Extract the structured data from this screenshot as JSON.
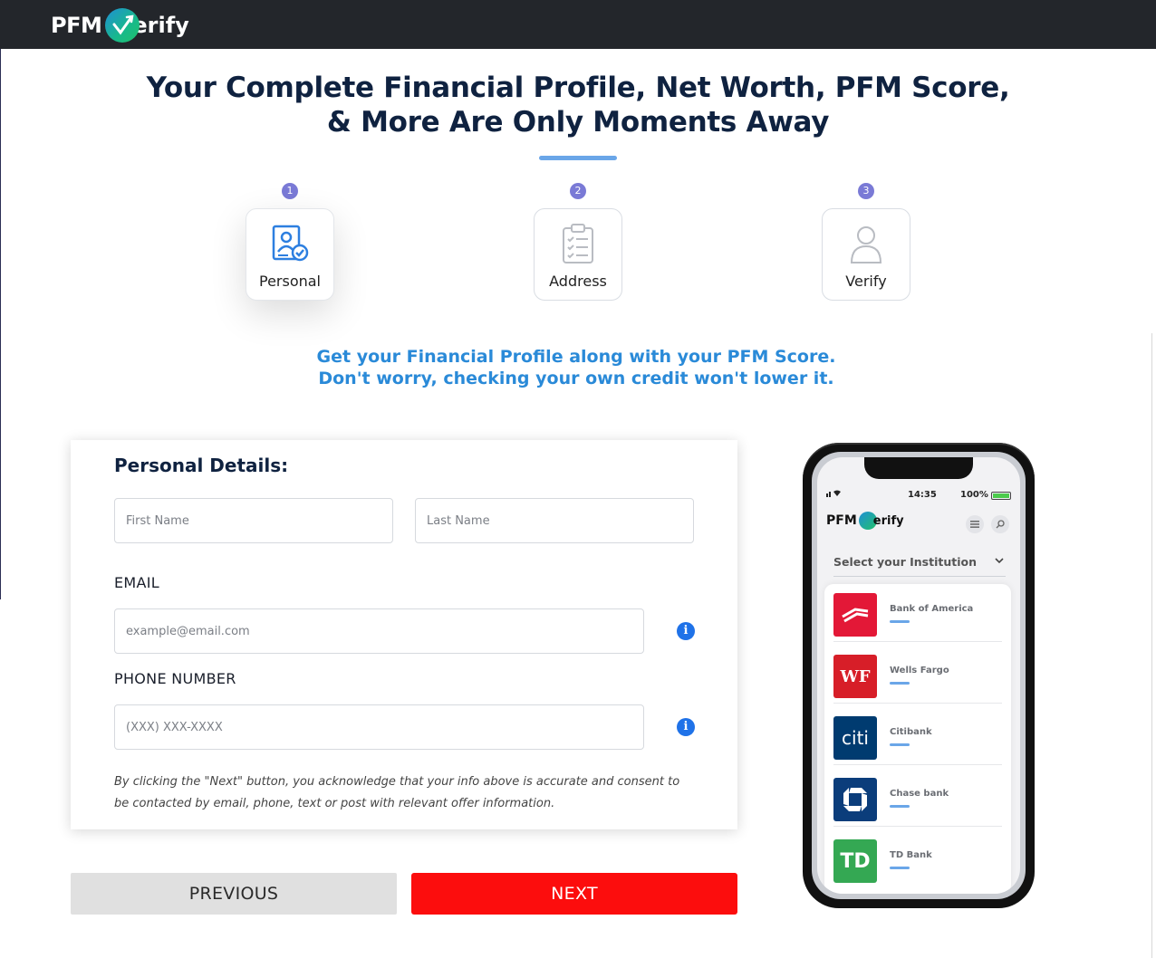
{
  "brand": {
    "prefix": "PFM",
    "suffix": "erify"
  },
  "headline": {
    "line1": "Your Complete Financial Profile, Net Worth, PFM Score,",
    "line2": "& More Are Only Moments Away"
  },
  "steps": [
    {
      "number": "1",
      "label": "Personal",
      "icon": "personal-id-check-icon",
      "active": true
    },
    {
      "number": "2",
      "label": "Address",
      "icon": "clipboard-checklist-icon",
      "active": false
    },
    {
      "number": "3",
      "label": "Verify",
      "icon": "user-outline-icon",
      "active": false
    }
  ],
  "subheadline": {
    "line1": "Get your Financial Profile along with your PFM Score.",
    "line2": "Don't worry, checking your own credit won't lower it."
  },
  "form": {
    "title": "Personal Details:",
    "first_name": {
      "placeholder": "First Name",
      "value": ""
    },
    "last_name": {
      "placeholder": "Last Name",
      "value": ""
    },
    "email": {
      "label": "EMAIL",
      "placeholder": "example@email.com",
      "value": ""
    },
    "phone": {
      "label": "PHONE NUMBER",
      "placeholder": "(XXX) XXX-XXXX",
      "value": ""
    },
    "info_icon": "i",
    "consent_line1": "By clicking the \"Next\" button, you acknowledge that your info above is accurate and consent to",
    "consent_line2": "be contacted by email, phone, text or post with relevant offer information."
  },
  "buttons": {
    "previous": "PREVIOUS",
    "next": "NEXT"
  },
  "phone_mockup": {
    "time": "14:35",
    "battery": "100%",
    "logo_prefix": "PFM",
    "logo_suffix": "erify",
    "select_label": "Select your Institution",
    "banks": [
      {
        "name": "Bank of America",
        "color": "#e31837",
        "mark": ""
      },
      {
        "name": "Wells Fargo",
        "color": "#d71e28",
        "mark": "WF"
      },
      {
        "name": "Citibank",
        "color": "#003b70",
        "mark": "citi"
      },
      {
        "name": "Chase bank",
        "color": "#0b3d7b",
        "mark": ""
      },
      {
        "name": "TD Bank",
        "color": "#34a853",
        "mark": "TD"
      }
    ]
  },
  "colors": {
    "accent_blue": "#2a8ad8",
    "next_red": "#fc0d0d",
    "topbar": "#23262b",
    "step_badge": "#7a7ad6"
  }
}
